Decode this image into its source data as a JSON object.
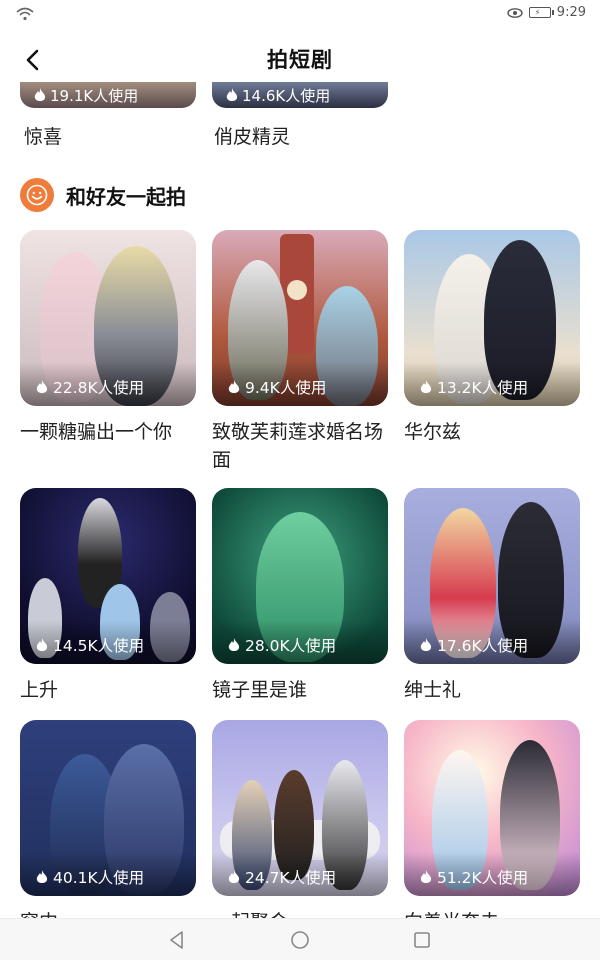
{
  "status": {
    "time": "9:29"
  },
  "header": {
    "title": "拍短剧"
  },
  "previous_row": [
    {
      "usage": "19.1K人使用",
      "title": "惊喜"
    },
    {
      "usage": "14.6K人使用",
      "title": "俏皮精灵"
    }
  ],
  "section": {
    "title": "和好友一起拍"
  },
  "cards": [
    {
      "usage": "22.8K人使用",
      "title": "一颗糖骗出一个你"
    },
    {
      "usage": "9.4K人使用",
      "title": "致敬芙莉莲求婚名场面"
    },
    {
      "usage": "13.2K人使用",
      "title": "华尔兹"
    },
    {
      "usage": "14.5K人使用",
      "title": "上升"
    },
    {
      "usage": "28.0K人使用",
      "title": "镜子里是谁"
    },
    {
      "usage": "17.6K人使用",
      "title": "绅士礼"
    },
    {
      "usage": "40.1K人使用",
      "title": "窗内"
    },
    {
      "usage": "24.7K人使用",
      "title": "一起聚会"
    },
    {
      "usage": "51.2K人使用",
      "title": "向着光奔去"
    }
  ]
}
